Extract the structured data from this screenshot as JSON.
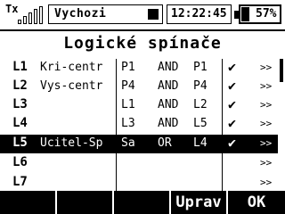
{
  "status": {
    "tx_label": "Tx",
    "signal_bars": 5,
    "model_name": "Vychozi",
    "time": "12:22:45",
    "battery_percent": "57%",
    "battery_level": 0.57
  },
  "title": "Logické spínače",
  "rows": [
    {
      "id": "L1",
      "name": "Kri-centr",
      "a": "P1",
      "op": "AND",
      "b": "P1",
      "check": "✔",
      "more": ">>"
    },
    {
      "id": "L2",
      "name": "Vys-centr",
      "a": "P4",
      "op": "AND",
      "b": "P4",
      "check": "✔",
      "more": ">>"
    },
    {
      "id": "L3",
      "name": "",
      "a": "L1",
      "op": "AND",
      "b": "L2",
      "check": "✔",
      "more": ">>"
    },
    {
      "id": "L4",
      "name": "",
      "a": "L3",
      "op": "AND",
      "b": "L5",
      "check": "✔",
      "more": ">>"
    },
    {
      "id": "L5",
      "name": "Ucitel-Sp",
      "a": "Sa",
      "op": "OR",
      "b": "L4",
      "check": "✔",
      "more": ">>"
    },
    {
      "id": "L6",
      "name": "",
      "a": "",
      "op": "",
      "b": "",
      "check": "",
      "more": ">>"
    },
    {
      "id": "L7",
      "name": "",
      "a": "",
      "op": "",
      "b": "",
      "check": "",
      "more": ">>"
    }
  ],
  "selected_row": 4,
  "fkeys": [
    "",
    "",
    "",
    "",
    "Uprav",
    "OK"
  ]
}
